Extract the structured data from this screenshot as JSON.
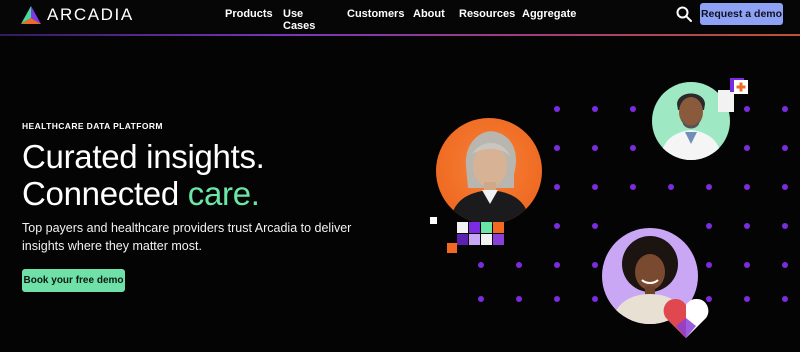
{
  "header": {
    "logo_text": "ARCADIA",
    "nav": [
      "Products",
      "Use Cases",
      "Customers",
      "About",
      "Resources",
      "Aggregate"
    ],
    "cta_label": "Request a demo"
  },
  "hero": {
    "eyebrow": "HEALTHCARE DATA PLATFORM",
    "headline_line1": "Curated insights.",
    "headline_line2_prefix": "Connected ",
    "headline_line2_accent": "care.",
    "subtext": "Top payers and healthcare providers trust Arcadia to deliver insights where they matter most.",
    "cta_label": "Book your free demo"
  },
  "colors": {
    "background": "#040404",
    "accent_green": "#6ce6a6",
    "button_blue": "#8ea2f5",
    "dot_purple": "#7b2be0",
    "orange": "#f26a21",
    "lavender": "#c9a7f5",
    "mint": "#9ee8c4"
  },
  "icons": {
    "search": "search-icon",
    "logo_mark": "arcadia-logo-icon",
    "medical_cross": "medical-cross-icon",
    "heart": "heart-icon"
  }
}
